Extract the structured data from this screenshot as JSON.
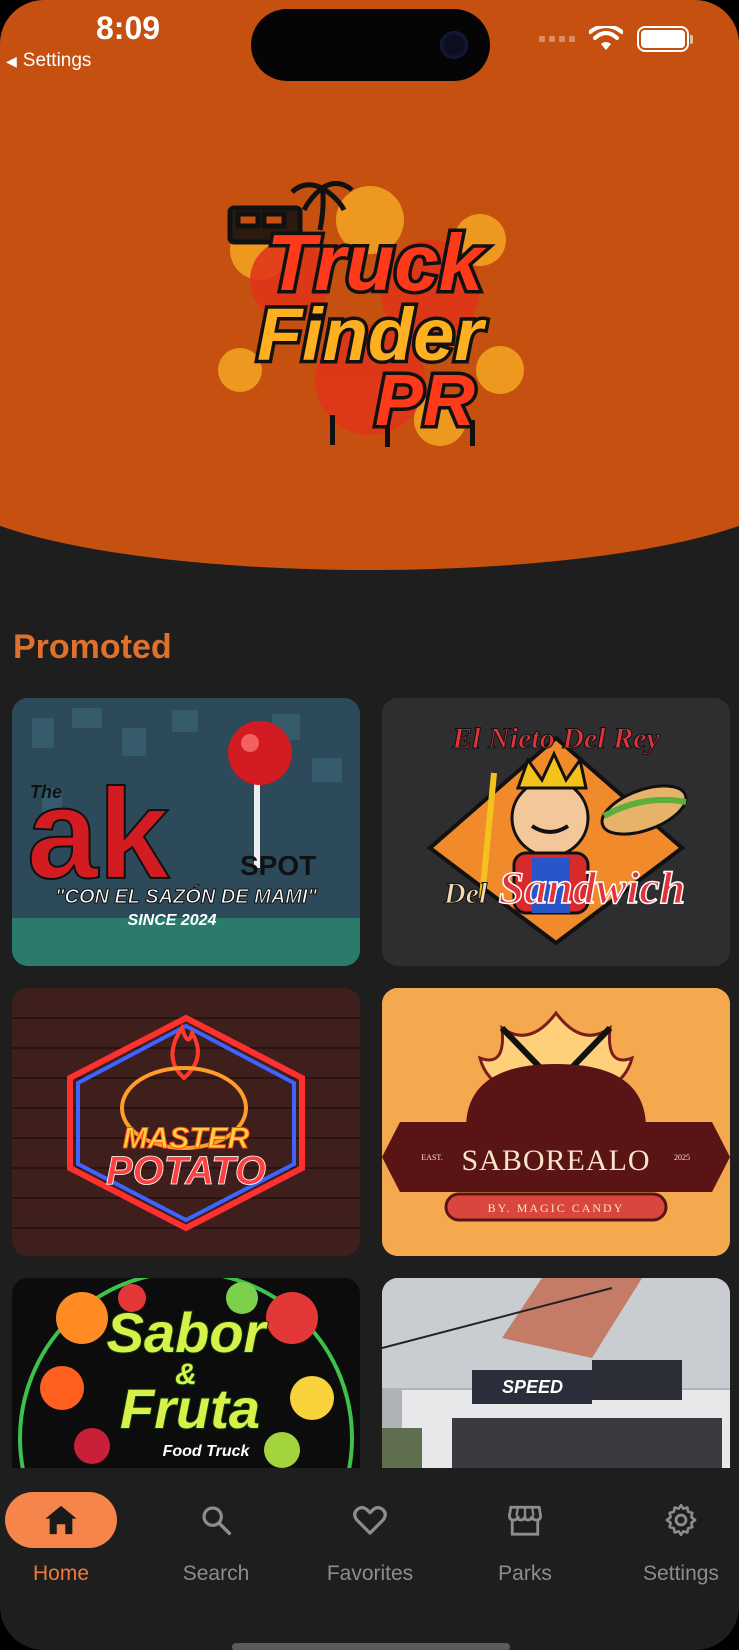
{
  "status_bar": {
    "time": "8:09",
    "back_label": "Settings"
  },
  "header": {
    "logo_lines": [
      "Truck",
      "Finder",
      "PR"
    ]
  },
  "promoted": {
    "title": "Promoted",
    "cards": [
      {
        "name": "The AK Spot",
        "logo_text": "ak",
        "prefix": "The",
        "suffix": "SPOT",
        "tagline": "\"CON EL SAZÓN DE MAMI\"",
        "since": "SINCE 2024"
      },
      {
        "name": "El Nieto Del Rey Del Sandwich",
        "arc_text": "El Nieto Del Rey",
        "word1": "Del",
        "word2": "Sandwich"
      },
      {
        "name": "Master Potato",
        "word1": "MASTER",
        "word2": "POTATO"
      },
      {
        "name": "Saborealo",
        "word": "SABOREALO",
        "sub": "BY. MAGIC CANDY",
        "left_small": "EAST.",
        "right_small": "2025"
      },
      {
        "name": "Sabor & Fruta",
        "word1": "Sabor",
        "amp": "&",
        "word2": "Fruta",
        "sub": "Food Truck"
      },
      {
        "name": "Speed Truck",
        "sign": "SPEED"
      }
    ]
  },
  "tabs": [
    {
      "label": "Home",
      "icon": "home-icon",
      "active": true
    },
    {
      "label": "Search",
      "icon": "search-icon",
      "active": false
    },
    {
      "label": "Favorites",
      "icon": "heart-icon",
      "active": false
    },
    {
      "label": "Parks",
      "icon": "storefront-icon",
      "active": false
    },
    {
      "label": "Settings",
      "icon": "gear-icon",
      "active": false
    }
  ],
  "colors": {
    "header_orange": "#c6500f",
    "accent": "#f07a35",
    "background": "#1e1e1f"
  }
}
